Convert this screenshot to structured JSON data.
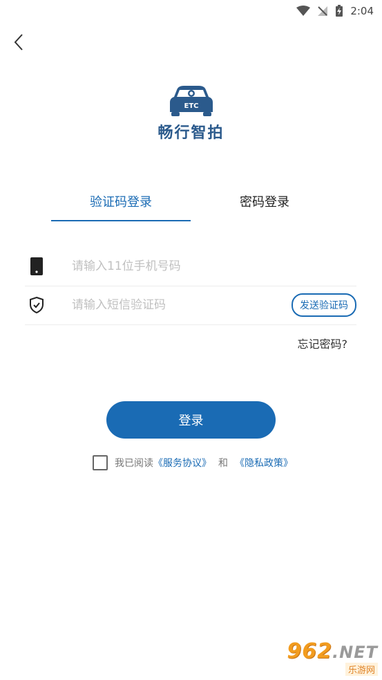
{
  "status_bar": {
    "time": "2:04"
  },
  "app": {
    "name": "畅行智拍",
    "logo_text": "ETC"
  },
  "tabs": [
    {
      "label": "验证码登录",
      "active": true
    },
    {
      "label": "密码登录",
      "active": false
    }
  ],
  "form": {
    "phone_placeholder": "请输入11位手机号码",
    "code_placeholder": "请输入短信验证码",
    "send_code_label": "发送验证码",
    "forgot_label": "忘记密码?",
    "login_label": "登录"
  },
  "agreement": {
    "prefix": "我已阅读",
    "service_link": "《服务协议》",
    "conj": "和",
    "privacy_link": "《隐私政策》",
    "checked": false
  },
  "watermark": {
    "number": "962",
    "suffix": ".NET",
    "site": "乐游网"
  },
  "colors": {
    "accent": "#1a6bb4",
    "logo": "#2b5a8c"
  }
}
